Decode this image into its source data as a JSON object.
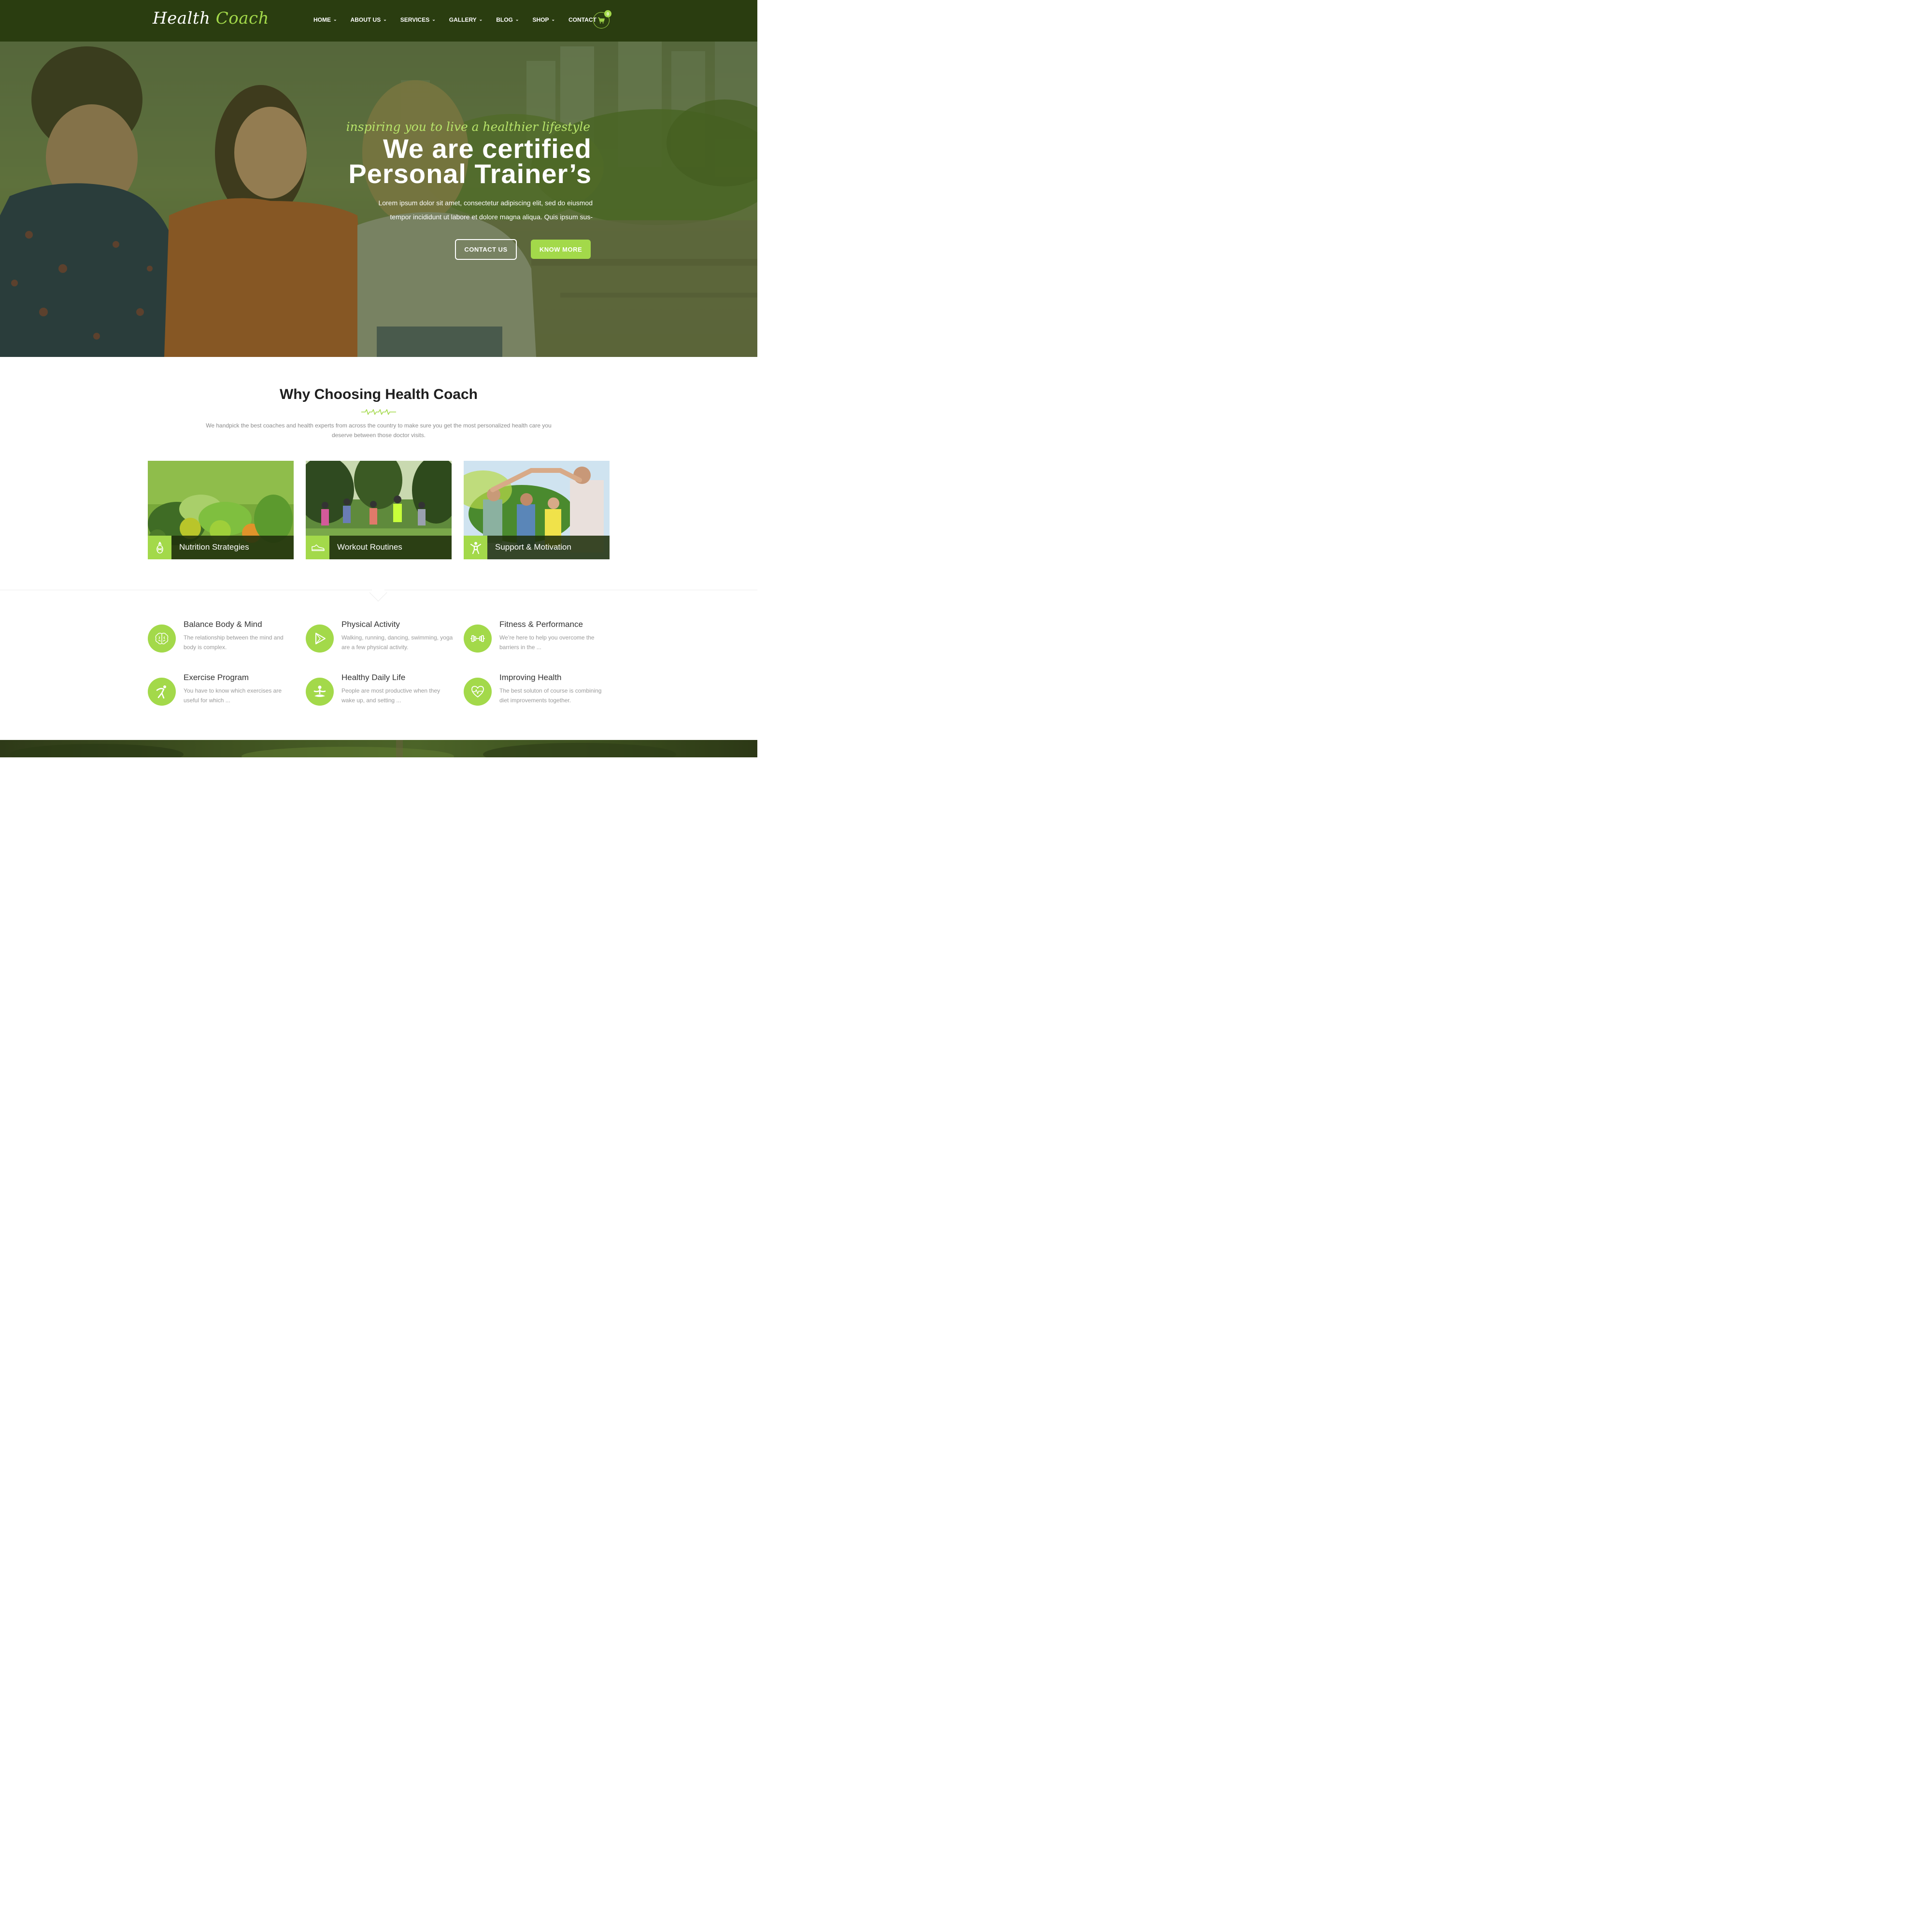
{
  "header": {
    "logo_primary": "Health",
    "logo_accent": "Coach",
    "nav": [
      {
        "label": "HOME",
        "dropdown": true
      },
      {
        "label": "ABOUT US",
        "dropdown": true
      },
      {
        "label": "SERVICES",
        "dropdown": true
      },
      {
        "label": "GALLERY",
        "dropdown": true
      },
      {
        "label": "BLOG",
        "dropdown": true
      },
      {
        "label": "SHOP",
        "dropdown": true
      },
      {
        "label": "CONTACT",
        "dropdown": false
      }
    ],
    "cart_icon": "shopping-cart-icon",
    "cart_count": "0"
  },
  "hero": {
    "tagline": "inspiring you to live a healthier lifestyle",
    "title_line1": "We are certified",
    "title_line2": "Personal Trainer’s",
    "text_line1": "Lorem ipsum dolor sit amet, consectetur adipiscing elit, sed do eiusmod",
    "text_line2": "tempor incididunt ut labore et dolore magna aliqua. Quis ipsum sus-",
    "button_outline": "CONTACT US",
    "button_fill": "KNOW MORE"
  },
  "why": {
    "title": "Why Choosing Health Coach",
    "divider_icon": "heartbeat-pulse-icon",
    "desc_line1": "We handpick the best coaches and health experts from across the country to make sure you get the most personalized health care you",
    "desc_line2": "deserve between those doctor visits.",
    "cards": [
      {
        "label": "Nutrition Strategies",
        "icon": "pineapple-icon"
      },
      {
        "label": "Workout Routines",
        "icon": "sneaker-icon"
      },
      {
        "label": "Support & Motivation",
        "icon": "person-raised-arms-icon"
      }
    ]
  },
  "features": [
    {
      "title": "Balance Body & Mind",
      "text": "The relationship between the mind and body is complex.",
      "icon": "brain-icon"
    },
    {
      "title": "Physical Activity",
      "text": "Walking, running, dancing, swimming, yoga are a few physical activity.",
      "icon": "play-triangle-icon"
    },
    {
      "title": "Fitness & Performance",
      "text": "We’re here to help you overcome the barriers in the ...",
      "icon": "dumbbell-icon"
    },
    {
      "title": "Exercise Program",
      "text": "You have to know which exercises are useful for which ...",
      "icon": "stretching-figure-icon"
    },
    {
      "title": "Healthy Daily Life",
      "text": "People are most productive when they wake up, and setting ...",
      "icon": "meditation-figure-icon"
    },
    {
      "title": "Improving Health",
      "text": "The best soluton of course is combining diet improvements together.",
      "icon": "heart-pulse-icon"
    }
  ],
  "colors": {
    "accent": "#a3d94a",
    "header_bg": "#2a3d10",
    "title_dark": "#1e1e1e",
    "muted_text": "#999999"
  }
}
